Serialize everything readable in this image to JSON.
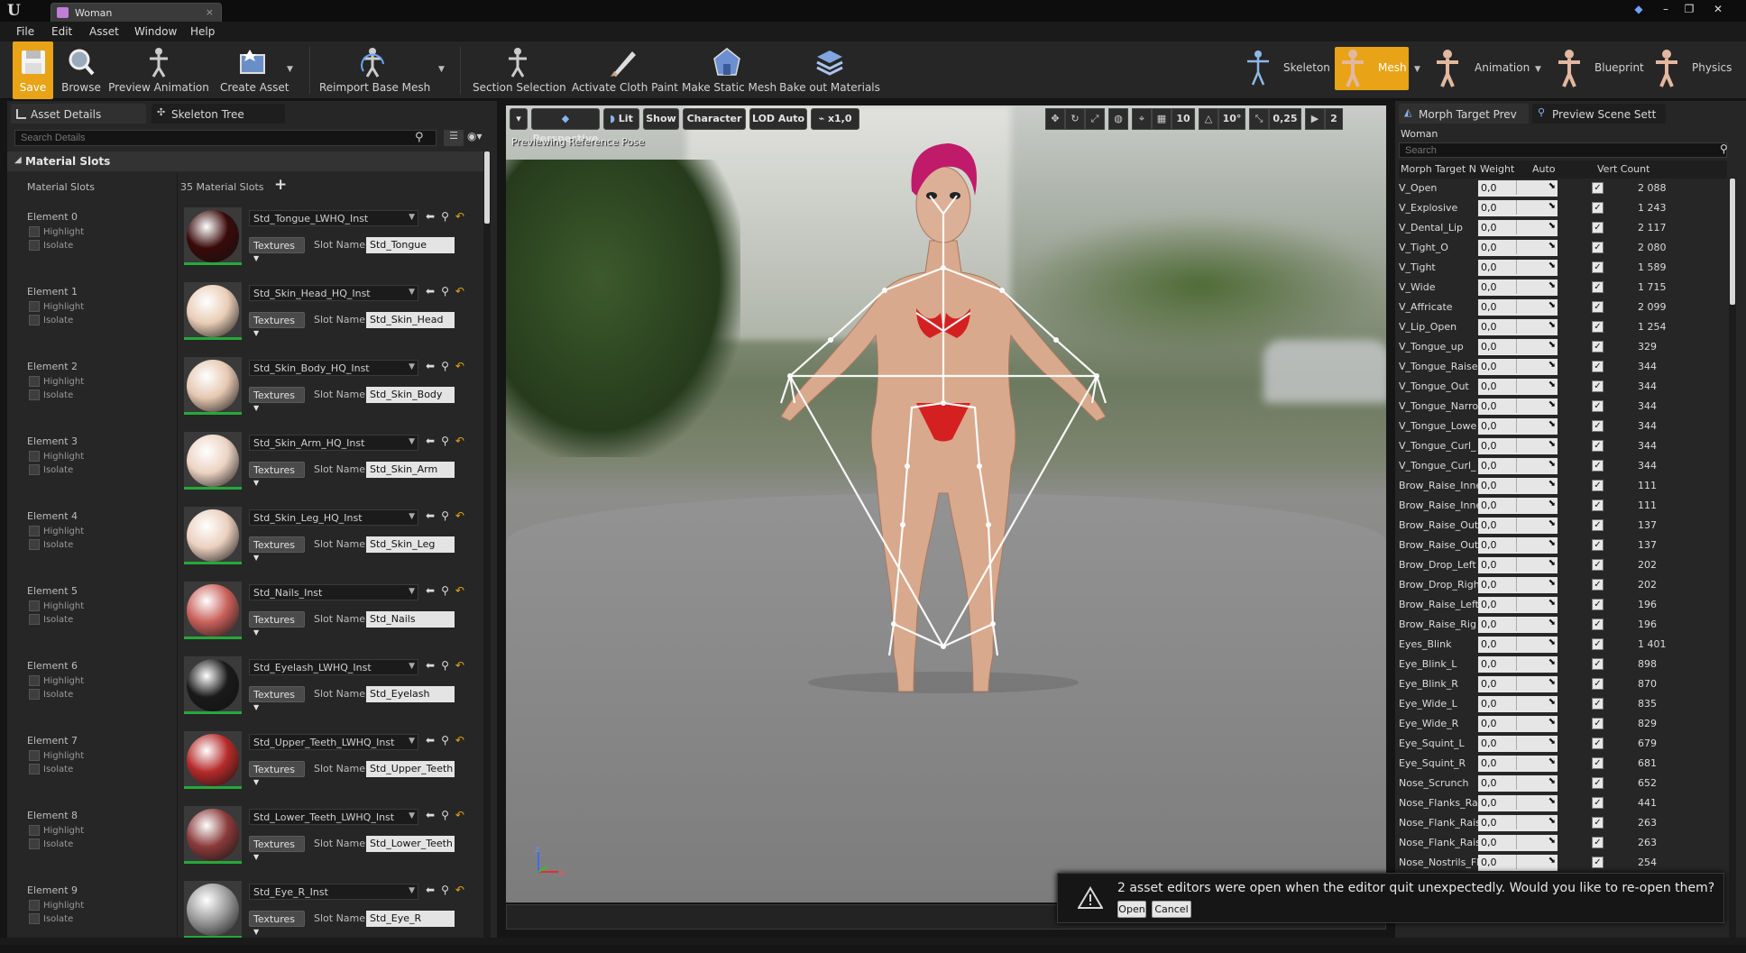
{
  "window": {
    "tab_title": "Woman",
    "close": "×"
  },
  "menu": [
    "File",
    "Edit",
    "Asset",
    "Window",
    "Help"
  ],
  "toolbar": {
    "buttons": [
      {
        "label": "Save",
        "icon": "save-icon"
      },
      {
        "label": "Browse",
        "icon": "browse-icon"
      },
      {
        "label": "Preview Animation",
        "icon": "preview-animation-icon"
      },
      {
        "label": "Create Asset",
        "icon": "create-asset-icon"
      },
      {
        "label": "Reimport Base Mesh",
        "icon": "reimport-icon"
      },
      {
        "label": "Section Selection",
        "icon": "section-selection-icon"
      },
      {
        "label": "Activate Cloth Paint",
        "icon": "cloth-paint-icon"
      },
      {
        "label": "Make Static Mesh",
        "icon": "static-mesh-icon"
      },
      {
        "label": "Bake out Materials",
        "icon": "bake-materials-icon"
      }
    ],
    "modes": [
      {
        "label": "Skeleton"
      },
      {
        "label": "Mesh"
      },
      {
        "label": "Animation"
      },
      {
        "label": "Blueprint"
      },
      {
        "label": "Physics"
      }
    ]
  },
  "left_panel": {
    "tabs": [
      "Asset Details",
      "Skeleton Tree"
    ],
    "search_placeholder": "Search Details",
    "section_title": "Material Slots",
    "slots_label": "Material Slots",
    "slots_count": "35 Material Slots",
    "add": "+",
    "highlight": "Highlight",
    "isolate": "Isolate",
    "textures": "Textures",
    "slot_name_label": "Slot Name",
    "elements": [
      {
        "element": "Element 0",
        "material": "Std_Tongue_LWHQ_Inst",
        "slot": "Std_Tongue",
        "color": "#3a0a0a"
      },
      {
        "element": "Element 1",
        "material": "Std_Skin_Head_HQ_Inst",
        "slot": "Std_Skin_Head",
        "color": "#e9cdb6"
      },
      {
        "element": "Element 2",
        "material": "Std_Skin_Body_HQ_Inst",
        "slot": "Std_Skin_Body",
        "color": "#e6c8b2"
      },
      {
        "element": "Element 3",
        "material": "Std_Skin_Arm_HQ_Inst",
        "slot": "Std_Skin_Arm",
        "color": "#ecd3c2"
      },
      {
        "element": "Element 4",
        "material": "Std_Skin_Leg_HQ_Inst",
        "slot": "Std_Skin_Leg",
        "color": "#ebd0bf"
      },
      {
        "element": "Element 5",
        "material": "Std_Nails_Inst",
        "slot": "Std_Nails",
        "color": "#c9605a"
      },
      {
        "element": "Element 6",
        "material": "Std_Eyelash_LWHQ_Inst",
        "slot": "Std_Eyelash",
        "color": "#1a1a1a"
      },
      {
        "element": "Element 7",
        "material": "Std_Upper_Teeth_LWHQ_Inst",
        "slot": "Std_Upper_Teeth",
        "color": "#b52a2a"
      },
      {
        "element": "Element 8",
        "material": "Std_Lower_Teeth_LWHQ_Inst",
        "slot": "Std_Lower_Teeth",
        "color": "#8a3a3a"
      },
      {
        "element": "Element 9",
        "material": "Std_Eye_R_Inst",
        "slot": "Std_Eye_R",
        "color": "#9a9a9a"
      }
    ]
  },
  "viewport": {
    "perspective": "Perspective",
    "lit": "Lit",
    "show": "Show",
    "character": "Character",
    "lod": "LOD Auto",
    "speed": "x1,0",
    "grid": "10",
    "rotation": "10°",
    "scale": "0,25",
    "camera_speed": "2",
    "caption": "Previewing Reference Pose",
    "axis_z": "z",
    "axis_x": "x"
  },
  "right_panel": {
    "tabs": [
      "Morph Target Prev",
      "Preview Scene Sett"
    ],
    "asset_name": "Woman",
    "search_placeholder": "Search",
    "columns": [
      "Morph Target N",
      "Weight",
      "Auto",
      "Vert Count"
    ],
    "check": "✓",
    "rows": [
      {
        "name": "V_Open",
        "weight": "0,0",
        "verts": "2 088"
      },
      {
        "name": "V_Explosive",
        "weight": "0,0",
        "verts": "1 243"
      },
      {
        "name": "V_Dental_Lip",
        "weight": "0,0",
        "verts": "2 117"
      },
      {
        "name": "V_Tight_O",
        "weight": "0,0",
        "verts": "2 080"
      },
      {
        "name": "V_Tight",
        "weight": "0,0",
        "verts": "1 589"
      },
      {
        "name": "V_Wide",
        "weight": "0,0",
        "verts": "1 715"
      },
      {
        "name": "V_Affricate",
        "weight": "0,0",
        "verts": "2 099"
      },
      {
        "name": "V_Lip_Open",
        "weight": "0,0",
        "verts": "1 254"
      },
      {
        "name": "V_Tongue_up",
        "weight": "0,0",
        "verts": "329"
      },
      {
        "name": "V_Tongue_Raise",
        "weight": "0,0",
        "verts": "344"
      },
      {
        "name": "V_Tongue_Out",
        "weight": "0,0",
        "verts": "344"
      },
      {
        "name": "V_Tongue_Narro",
        "weight": "0,0",
        "verts": "344"
      },
      {
        "name": "V_Tongue_Lowe",
        "weight": "0,0",
        "verts": "344"
      },
      {
        "name": "V_Tongue_Curl_",
        "weight": "0,0",
        "verts": "344"
      },
      {
        "name": "V_Tongue_Curl_",
        "weight": "0,0",
        "verts": "344"
      },
      {
        "name": "Brow_Raise_Inne",
        "weight": "0,0",
        "verts": "111"
      },
      {
        "name": "Brow_Raise_Inne",
        "weight": "0,0",
        "verts": "111"
      },
      {
        "name": "Brow_Raise_Out",
        "weight": "0,0",
        "verts": "137"
      },
      {
        "name": "Brow_Raise_Out",
        "weight": "0,0",
        "verts": "137"
      },
      {
        "name": "Brow_Drop_Left",
        "weight": "0,0",
        "verts": "202"
      },
      {
        "name": "Brow_Drop_Righ",
        "weight": "0,0",
        "verts": "202"
      },
      {
        "name": "Brow_Raise_Left",
        "weight": "0,0",
        "verts": "196"
      },
      {
        "name": "Brow_Raise_Rig",
        "weight": "0,0",
        "verts": "196"
      },
      {
        "name": "Eyes_Blink",
        "weight": "0,0",
        "verts": "1 401"
      },
      {
        "name": "Eye_Blink_L",
        "weight": "0,0",
        "verts": "898"
      },
      {
        "name": "Eye_Blink_R",
        "weight": "0,0",
        "verts": "870"
      },
      {
        "name": "Eye_Wide_L",
        "weight": "0,0",
        "verts": "835"
      },
      {
        "name": "Eye_Wide_R",
        "weight": "0,0",
        "verts": "829"
      },
      {
        "name": "Eye_Squint_L",
        "weight": "0,0",
        "verts": "679"
      },
      {
        "name": "Eye_Squint_R",
        "weight": "0,0",
        "verts": "681"
      },
      {
        "name": "Nose_Scrunch",
        "weight": "0,0",
        "verts": "652"
      },
      {
        "name": "Nose_Flanks_Ra",
        "weight": "0,0",
        "verts": "441"
      },
      {
        "name": "Nose_Flank_Rais",
        "weight": "0,0",
        "verts": "263"
      },
      {
        "name": "Nose_Flank_Rais",
        "weight": "0,0",
        "verts": "263"
      },
      {
        "name": "Nose_Nostrils_Fl",
        "weight": "0,0",
        "verts": "254"
      }
    ]
  },
  "notification": {
    "message": "2 asset editors were open when the editor quit unexpectedly. Would you like to re-open them?",
    "open": "Open",
    "cancel": "Cancel"
  },
  "colors": {
    "accent": "#e8a317",
    "check_green": "#26a83a"
  }
}
